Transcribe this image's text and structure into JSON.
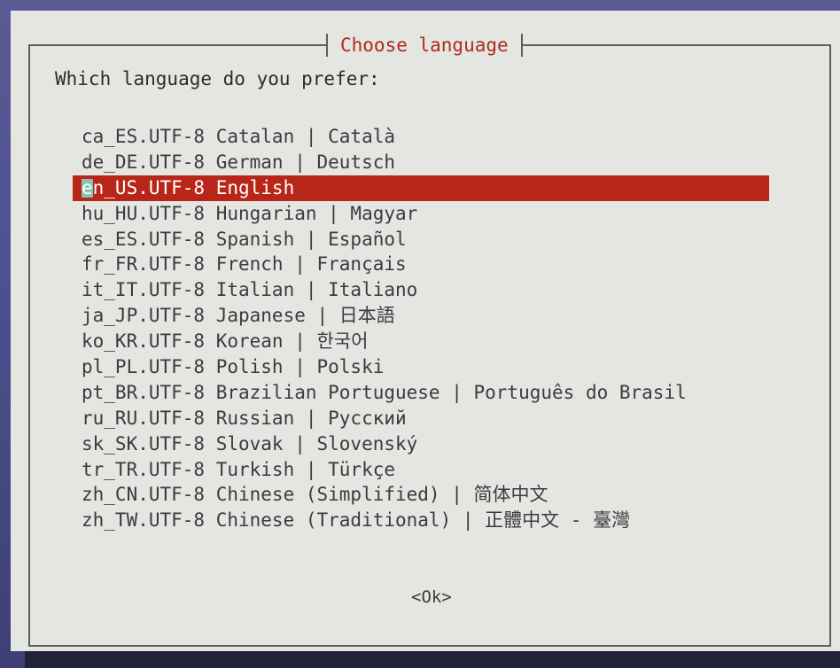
{
  "dialog": {
    "title": "Choose language",
    "prompt": "Which language do you prefer:",
    "ok_label": "<Ok>"
  },
  "languages": [
    {
      "label": "ca_ES.UTF-8 Catalan | Català",
      "selected": false
    },
    {
      "label": "de_DE.UTF-8 German | Deutsch",
      "selected": false
    },
    {
      "label": "en_US.UTF-8 English",
      "selected": true
    },
    {
      "label": "hu_HU.UTF-8 Hungarian | Magyar",
      "selected": false
    },
    {
      "label": "es_ES.UTF-8 Spanish | Español",
      "selected": false
    },
    {
      "label": "fr_FR.UTF-8 French | Français",
      "selected": false
    },
    {
      "label": "it_IT.UTF-8 Italian | Italiano",
      "selected": false
    },
    {
      "label": "ja_JP.UTF-8 Japanese | 日本語",
      "selected": false
    },
    {
      "label": "ko_KR.UTF-8 Korean | 한국어",
      "selected": false
    },
    {
      "label": "pl_PL.UTF-8 Polish | Polski",
      "selected": false
    },
    {
      "label": "pt_BR.UTF-8 Brazilian Portuguese | Português do Brasil",
      "selected": false
    },
    {
      "label": "ru_RU.UTF-8 Russian | Русский",
      "selected": false
    },
    {
      "label": "sk_SK.UTF-8 Slovak | Slovenský",
      "selected": false
    },
    {
      "label": "tr_TR.UTF-8 Turkish | Türkçe",
      "selected": false
    },
    {
      "label": "zh_CN.UTF-8 Chinese (Simplified) | 简体中文",
      "selected": false
    },
    {
      "label": "zh_TW.UTF-8 Chinese (Traditional) | 正體中文 - 臺灣",
      "selected": false
    }
  ],
  "colors": {
    "title": "#b02a1a",
    "selection": "#b8261a",
    "dialog_bg": "#e4e6e2",
    "screen_bg": "#4f5190"
  }
}
